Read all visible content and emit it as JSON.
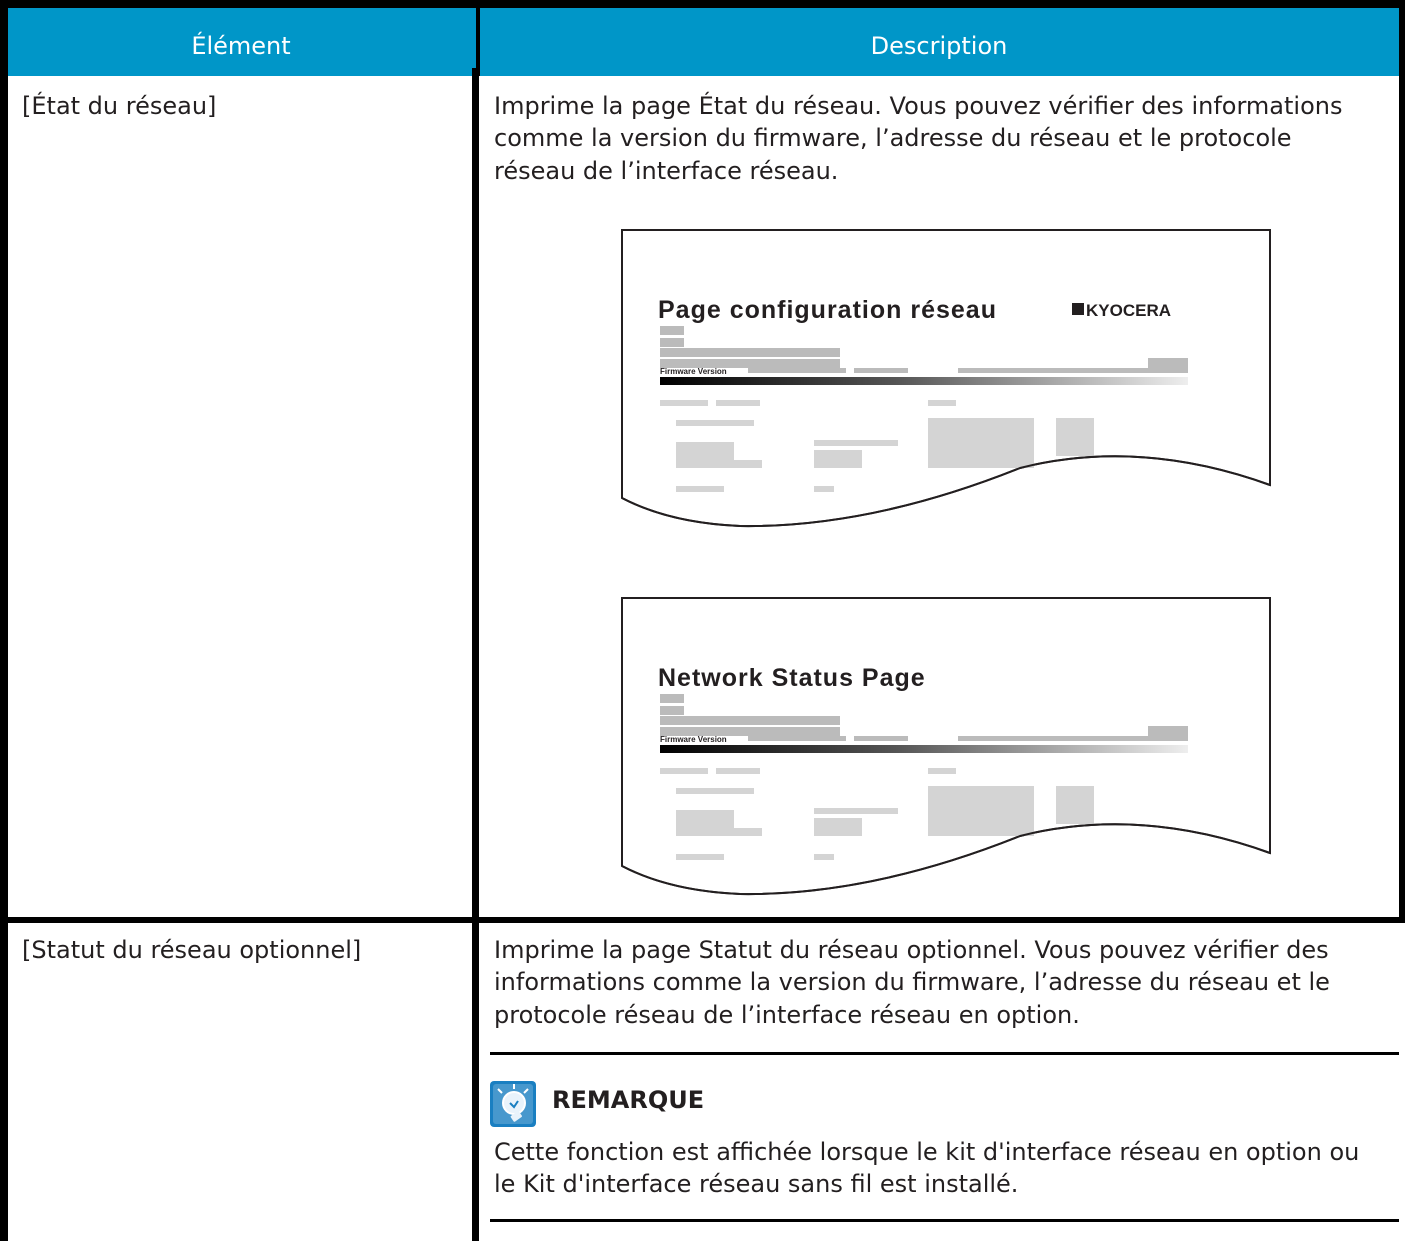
{
  "table": {
    "headers": [
      "Élément",
      "Description"
    ],
    "rows": [
      {
        "item": "[État du réseau]",
        "description": [
          "Imprime la page État du réseau. Vous pouvez vérifier des informations",
          "comme la version du firmware, l’adresse du réseau et le protocole",
          "réseau de l’interface réseau."
        ]
      },
      {
        "item": "[Statut du réseau optionnel]",
        "description": [
          "Imprime la page Statut du réseau optionnel. Vous pouvez vérifier des",
          "informations comme la version du firmware, l’adresse du réseau et le",
          "protocole réseau de l’interface réseau en option."
        ]
      }
    ]
  },
  "illustrations": [
    {
      "title": "Page configuration réseau",
      "logo": "KYOCERA",
      "firmware_label": "Firmware Version"
    },
    {
      "title": "Network Status Page",
      "firmware_label": "Firmware Version"
    }
  ],
  "note": {
    "icon": "lightbulb-icon",
    "heading": "REMARQUE",
    "text": [
      "Cette fonction est affichée lorsque le kit d'interface réseau en option ou",
      "le Kit d'interface réseau sans fil est installé."
    ]
  },
  "colors": {
    "header_bg": "#0096c8",
    "header_text": "#ffffff",
    "border": "#000000",
    "icon_bg": "#1a7fc1"
  }
}
